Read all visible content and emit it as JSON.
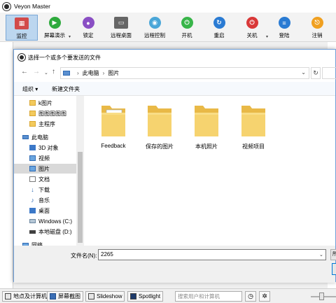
{
  "window": {
    "title": "Veyon Master"
  },
  "toolbar": [
    {
      "label": "监控",
      "color": "#d24a4a",
      "icon": "monitor-icon",
      "active": true
    },
    {
      "label": "屏幕演示",
      "color": "#2eaa3d",
      "icon": "presentation-icon"
    },
    {
      "label": "锁定",
      "color": "#8a4fc4",
      "icon": "lock-icon"
    },
    {
      "label": "远程桌面",
      "color": "#666666",
      "icon": "remote-desktop-icon"
    },
    {
      "label": "远程控制",
      "color": "#4aa6d8",
      "icon": "remote-control-icon"
    },
    {
      "label": "开机",
      "color": "#38b549",
      "icon": "power-on-icon"
    },
    {
      "label": "重启",
      "color": "#2a7bd3",
      "icon": "reboot-icon"
    },
    {
      "label": "关机",
      "color": "#d93838",
      "icon": "shutdown-icon"
    },
    {
      "label": "登陆",
      "color": "#2a7bd3",
      "icon": "login-icon"
    },
    {
      "label": "注销",
      "color": "#f0a020",
      "icon": "logout-icon"
    }
  ],
  "dialog": {
    "title": "选择一个或多个要发送的文件",
    "path": [
      "此电脑",
      "图片"
    ],
    "commands": {
      "organize": "组织 ▾",
      "new_folder": "新建文件夹"
    },
    "nav": [
      {
        "label": "k图片",
        "icon": "folder"
      },
      {
        "label": "图图图图图",
        "icon": "folder"
      },
      {
        "label": "主程序",
        "icon": "folder"
      },
      {
        "label": "此电脑",
        "icon": "pc"
      },
      {
        "label": "3D 对象",
        "icon": "blue"
      },
      {
        "label": "视频",
        "icon": "img"
      },
      {
        "label": "图片",
        "icon": "img",
        "selected": true
      },
      {
        "label": "文档",
        "icon": "doc"
      },
      {
        "label": "下载",
        "icon": "down"
      },
      {
        "label": "音乐",
        "icon": "music"
      },
      {
        "label": "桌面",
        "icon": "blue"
      },
      {
        "label": "Windows (C:)",
        "icon": "drive"
      },
      {
        "label": "本地磁盘 (D:)",
        "icon": "drive2"
      },
      {
        "label": "网络",
        "icon": "net"
      }
    ],
    "files": [
      {
        "name": "Feedback",
        "kind": "folder-with-doc"
      },
      {
        "name": "保存的图片",
        "kind": "folder"
      },
      {
        "name": "本机照片",
        "kind": "folder"
      },
      {
        "name": "视频项目",
        "kind": "folder"
      }
    ],
    "filename_label": "文件名(N):",
    "filename_value": "2265",
    "type_button_text": "所"
  },
  "bottombar": {
    "locations_label": "地点及计算机",
    "screenshots_label": "屏幕截图",
    "slideshow_label": "Slideshow",
    "spotlight_label": "Spotlight",
    "search_placeholder": "搜索用户和计算机"
  }
}
